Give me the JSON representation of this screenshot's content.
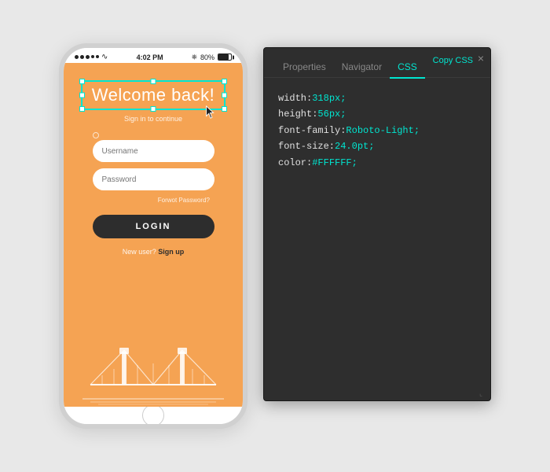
{
  "phone": {
    "status_bar": {
      "time": "4:02 PM",
      "battery_percent": "80%",
      "bluetooth_label": "BT"
    },
    "welcome_text": "Welcome back!",
    "sign_in_text": "Sign in to continue",
    "username_placeholder": "Username",
    "password_placeholder": "Password",
    "forgot_password": "Forwot Password?",
    "login_button": "LOGIN",
    "new_user_text": "New user?",
    "sign_up_text": "Sign up"
  },
  "panel": {
    "tabs": [
      "Properties",
      "Navigator",
      "CSS"
    ],
    "active_tab": "CSS",
    "copy_button": "Copy CSS",
    "close_button": "×",
    "css_properties": [
      {
        "prop": "width: ",
        "val": "318px;"
      },
      {
        "prop": "height: ",
        "val": "56px;"
      },
      {
        "prop": "font-family: ",
        "val": "Roboto-Light;"
      },
      {
        "prop": "font-size: ",
        "val": "24.0pt;"
      },
      {
        "prop": "color: ",
        "val": "#FFFFFF;"
      }
    ]
  },
  "colors": {
    "accent": "#00e5d0",
    "phone_bg": "#f5a353",
    "panel_bg": "#2e2e2e",
    "dark_button": "#2d2d2d"
  }
}
